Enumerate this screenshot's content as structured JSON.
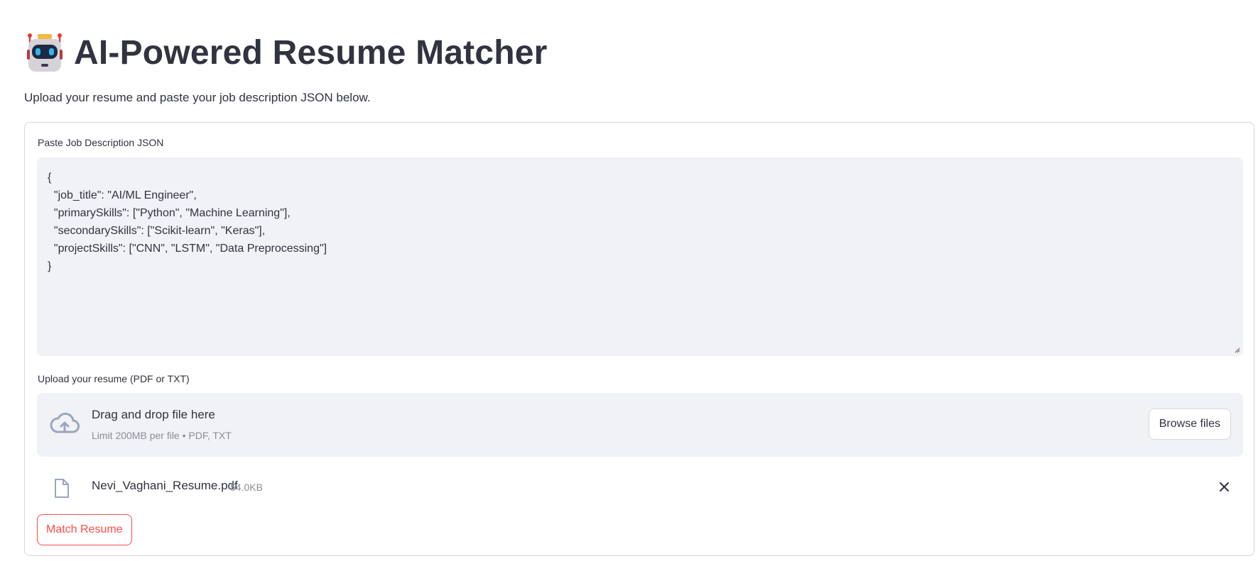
{
  "header": {
    "icon": "robot-icon",
    "title": "AI-Powered Resume Matcher",
    "subtitle": "Upload your resume and paste your job description JSON below."
  },
  "job_description": {
    "label": "Paste Job Description JSON",
    "value": "{\n  \"job_title\": \"AI/ML Engineer\",\n  \"primarySkills\": [\"Python\", \"Machine Learning\"],\n  \"secondarySkills\": [\"Scikit-learn\", \"Keras\"],\n  \"projectSkills\": [\"CNN\", \"LSTM\", \"Data Preprocessing\"]\n}"
  },
  "uploader": {
    "label": "Upload your resume (PDF or TXT)",
    "drop_title": "Drag and drop file here",
    "limit_text": "Limit 200MB per file • PDF, TXT",
    "browse_label": "Browse files",
    "icon": "cloud-upload-icon"
  },
  "uploaded_file": {
    "name": "Nevi_Vaghani_Resume.pdf",
    "size": "54.0KB",
    "icon": "file-icon",
    "remove_icon": "close-icon"
  },
  "actions": {
    "match_label": "Match Resume"
  },
  "colors": {
    "accent": "#ff4b4b",
    "text": "#31333f",
    "muted": "#8a8d96",
    "input_bg": "#f0f2f6",
    "border": "#d6d6d9"
  }
}
